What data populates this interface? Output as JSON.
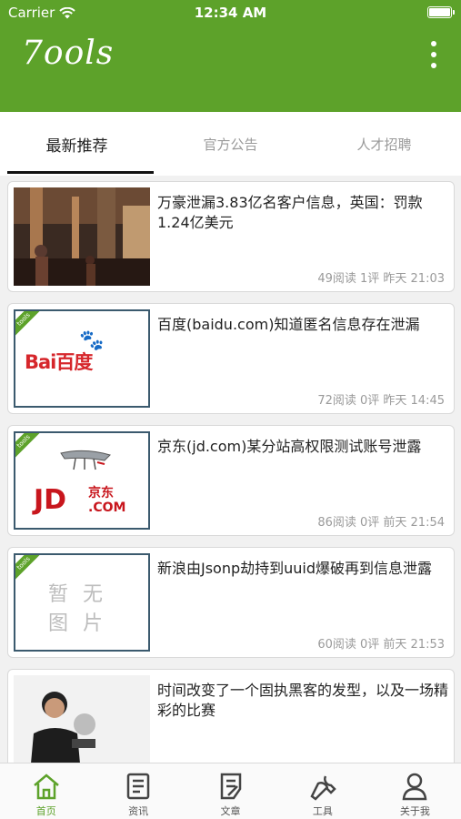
{
  "status_bar": {
    "carrier": "Carrier",
    "time": "12:34 AM"
  },
  "header": {
    "logo_text": "7ools",
    "more_icon": "more-vertical-icon"
  },
  "tabs": [
    {
      "label": "最新推荐",
      "active": true
    },
    {
      "label": "官方公告",
      "active": false
    },
    {
      "label": "人才招聘",
      "active": false
    }
  ],
  "articles": [
    {
      "title": "万豪泄漏3.83亿名客户信息，英国：罚款1.24亿美元",
      "meta": "49阅读 1评 昨天 21:03",
      "thumb": "photo-street"
    },
    {
      "title": "百度(baidu.com)知道匿名信息存在泄漏",
      "meta": "72阅读 0评 昨天 14:45",
      "thumb": "baidu-logo",
      "thumb_text": "Bai百度"
    },
    {
      "title": "京东(jd.com)某分站高权限测试账号泄露",
      "meta": "86阅读 0评 前天 21:54",
      "thumb": "jd-logo",
      "thumb_text": "JD",
      "thumb_text2": "京东",
      "thumb_text3": ".COM"
    },
    {
      "title": "新浪由Jsonp劫持到uuid爆破再到信息泄露",
      "meta": "60阅读 0评 前天 21:53",
      "thumb": "no-image",
      "thumb_text": "暂无",
      "thumb_text2": "图片"
    },
    {
      "title": "时间改变了一个固执黑客的发型，以及一场精彩的比赛",
      "meta": "",
      "thumb": "photo-person"
    }
  ],
  "thumb_tag": "tools",
  "bottom_nav": [
    {
      "label": "首页",
      "icon": "home-icon",
      "active": true
    },
    {
      "label": "资讯",
      "icon": "news-icon",
      "active": false
    },
    {
      "label": "文章",
      "icon": "article-icon",
      "active": false
    },
    {
      "label": "工具",
      "icon": "wrench-icon",
      "active": false
    },
    {
      "label": "关于我",
      "icon": "user-icon",
      "active": false
    }
  ],
  "colors": {
    "brand_green": "#5da22a"
  }
}
